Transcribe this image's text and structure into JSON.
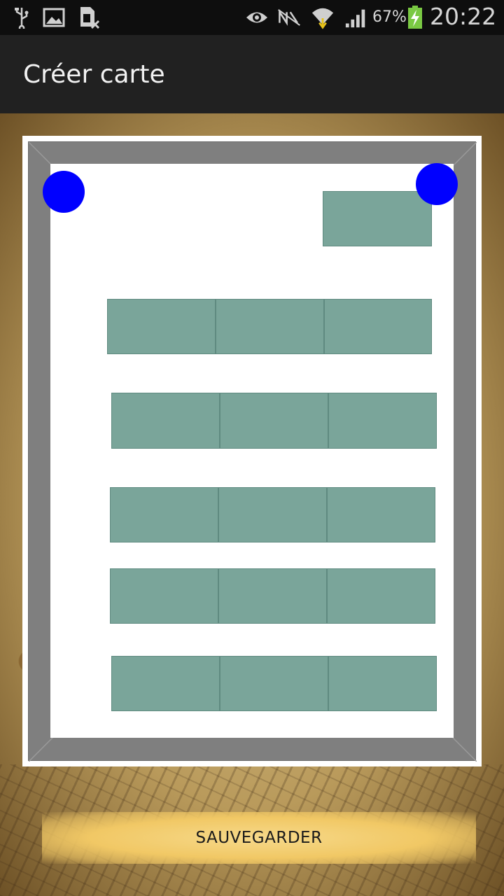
{
  "status_bar": {
    "icons": [
      "usb-icon",
      "image-icon",
      "sim-card-blocked-icon",
      "eye-icon",
      "nfc-muted-icon",
      "wifi-icon",
      "signal-icon",
      "battery-charging-icon"
    ],
    "battery": "67%",
    "time": "20:22"
  },
  "action_bar": {
    "title": "Créer carte"
  },
  "map": {
    "nodes": 2,
    "block_rows": 6
  },
  "save_button": {
    "label": "SAUVEGARDER"
  },
  "colors": {
    "node": "#0000ff",
    "block": "#7aa59a",
    "frame": "#7f7f7f",
    "action_bar": "#212121",
    "button": "#f1c865"
  }
}
